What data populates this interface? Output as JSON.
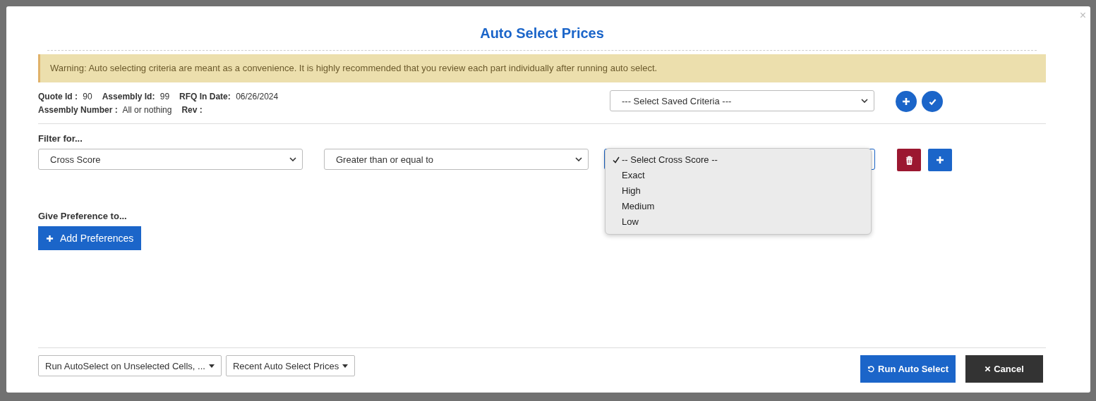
{
  "dialog": {
    "title": "Auto Select Prices",
    "close": "×"
  },
  "warning": "Warning: Auto selecting criteria are meant as a convenience. It is highly recommended that you review each part individually after running auto select.",
  "info_lines": [
    [
      {
        "label": "Quote Id :",
        "value": "90"
      },
      {
        "label": "Assembly Id:",
        "value": "99"
      },
      {
        "label": "RFQ In Date:",
        "value": "06/26/2024"
      }
    ],
    [
      {
        "label": "Assembly Number :",
        "value": "All or nothing"
      },
      {
        "label": "Rev :"
      }
    ]
  ],
  "saved_criteria": {
    "value": "--- Select Saved Criteria ---"
  },
  "filter_label": "Filter for...",
  "filters": [
    {
      "field": "Cross Score",
      "operator": "Greater than or equal to",
      "options": [
        {
          "label": "-- Select Cross Score --",
          "selected": true
        },
        {
          "label": "Exact",
          "selected": false
        },
        {
          "label": "High",
          "selected": false
        },
        {
          "label": "Medium",
          "selected": false
        },
        {
          "label": "Low",
          "selected": false
        }
      ]
    }
  ],
  "preference_label": "Give Preference to...",
  "add_preferences": "Add Preferences",
  "footer_menus": [
    "Run AutoSelect on Unselected Cells, ...",
    "Recent Auto Select Prices"
  ],
  "run_button": "Run Auto Select",
  "cancel_button": "Cancel"
}
